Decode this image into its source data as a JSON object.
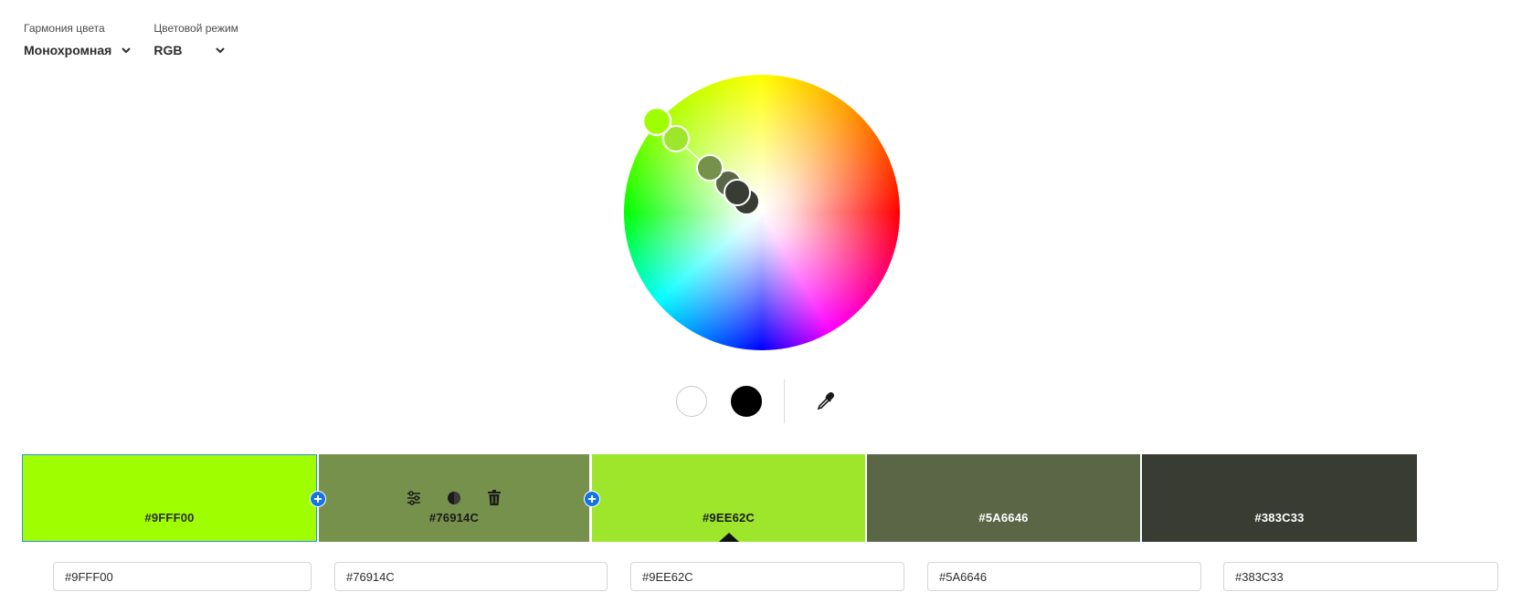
{
  "harmony": {
    "label": "Гармония цвета",
    "value": "Монохромная"
  },
  "mode": {
    "label": "Цветовой режим",
    "value": "RGB"
  },
  "wheel": {
    "markers": [
      "#9FFF00",
      "#76914C",
      "#9EE62C",
      "#5A6646",
      "#383C33"
    ]
  },
  "tools": {
    "white_icon": "white-circle",
    "black_icon": "black-circle",
    "eyedropper_icon": "eyedropper"
  },
  "swatches": [
    {
      "hex": "#9FFF00",
      "color": "#9FFF00",
      "text_color": "#2c2c2c"
    },
    {
      "hex": "#76914C",
      "color": "#76914C",
      "text_color": "#1a1a1a",
      "actions": [
        "sliders-icon",
        "contrast-icon",
        "trash-icon"
      ]
    },
    {
      "hex": "#9EE62C",
      "color": "#9EE62C",
      "text_color": "#1a1a1a"
    },
    {
      "hex": "#5A6646",
      "color": "#5A6646",
      "text_color": "#ffffff"
    },
    {
      "hex": "#383C33",
      "color": "#383C33",
      "text_color": "#ffffff"
    }
  ],
  "inputs": [
    "#9FFF00",
    "#76914C",
    "#9EE62C",
    "#5A6646",
    "#383C33"
  ],
  "accent": "#1473E6"
}
